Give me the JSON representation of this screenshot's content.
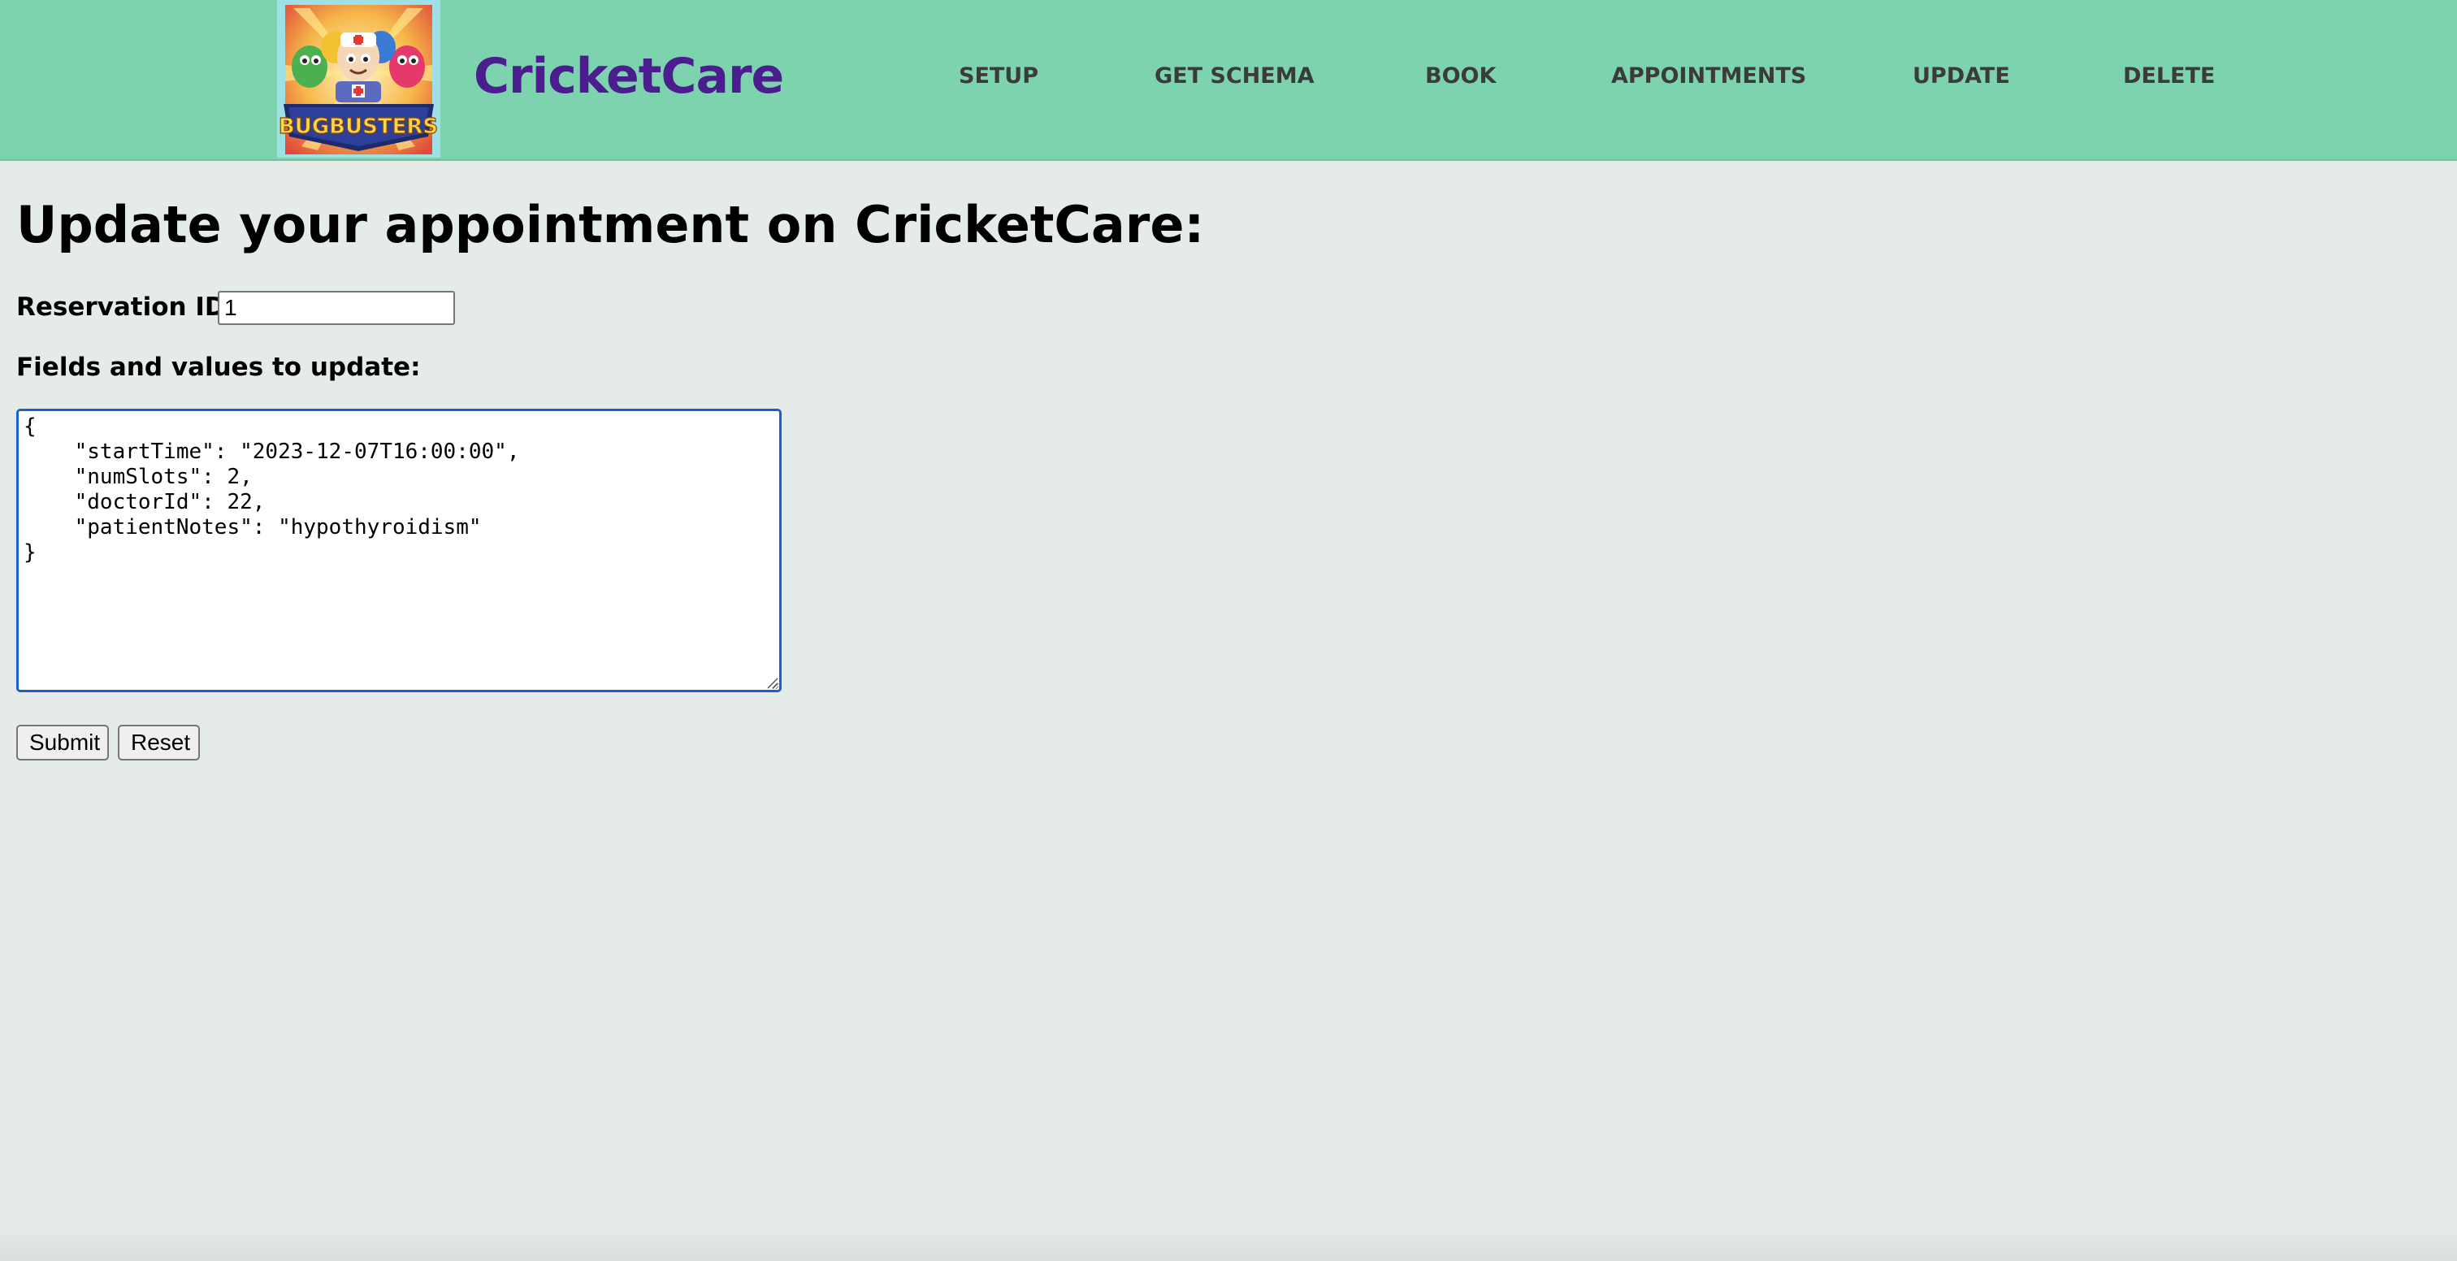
{
  "header": {
    "brand": "CricketCare",
    "logo_text": "BUGBUSTERS",
    "nav": [
      {
        "label": "SETUP"
      },
      {
        "label": "GET SCHEMA"
      },
      {
        "label": "BOOK"
      },
      {
        "label": "APPOINTMENTS"
      },
      {
        "label": "UPDATE"
      },
      {
        "label": "DELETE"
      }
    ],
    "colors": {
      "navbar_bg": "#7dd3ae",
      "brand": "#4b1d8f",
      "nav_link": "#3b3b3b"
    }
  },
  "main": {
    "title": "Update your appointment on CricketCare:",
    "reservation_label": "Reservation ID:",
    "reservation_value": "1",
    "fields_label": "Fields and values to update:",
    "fields_value": "{\n    \"startTime\": \"2023-12-07T16:00:00\",\n    \"numSlots\": 2,\n    \"doctorId\": 22,\n    \"patientNotes\": \"hypothyroidism\"\n}",
    "submit_label": "Submit",
    "reset_label": "Reset",
    "colors": {
      "page_bg": "#e5ebe8",
      "textarea_focus": "#1b5fd1"
    }
  }
}
